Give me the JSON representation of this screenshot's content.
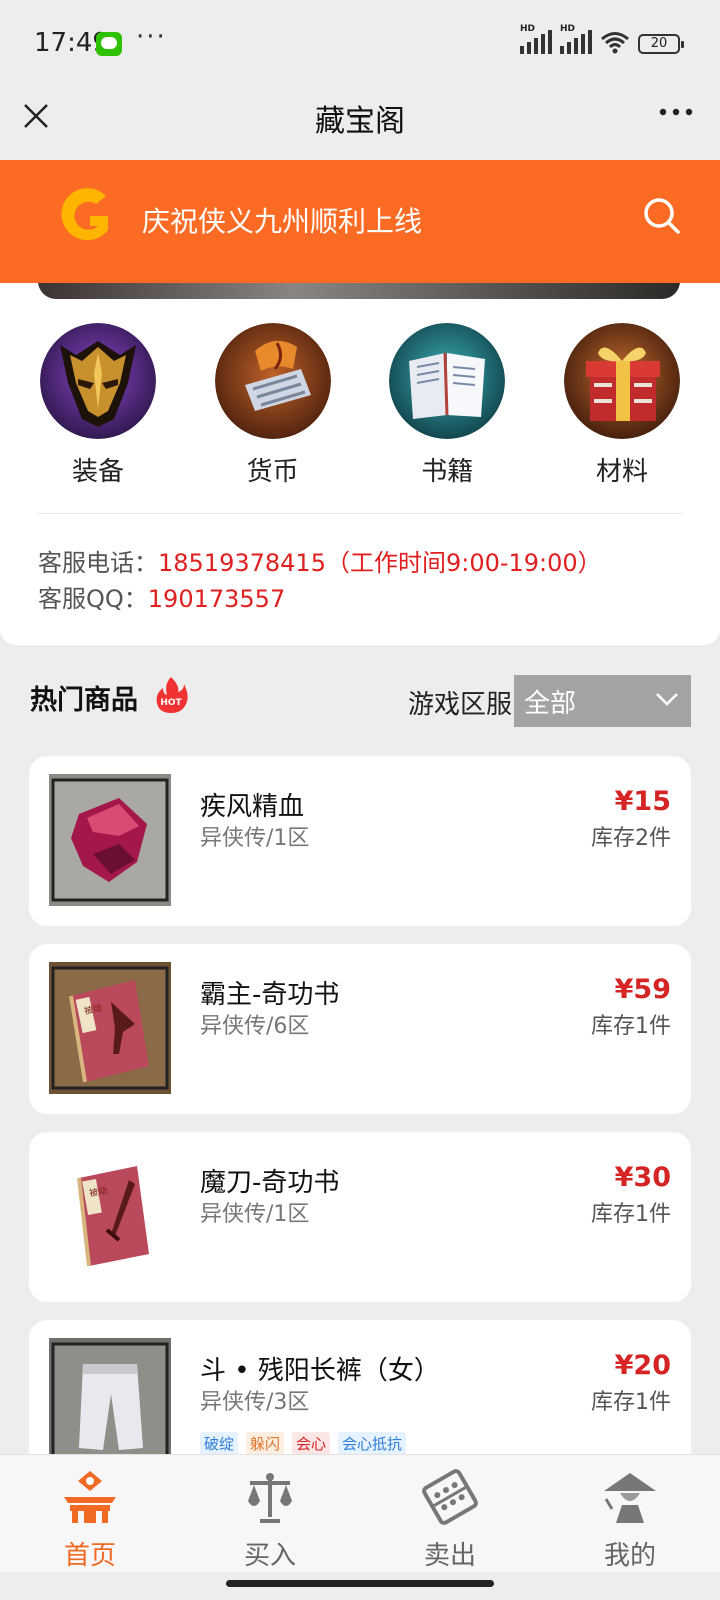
{
  "status_bar": {
    "time": "17:49",
    "battery": "20",
    "hd1": "HD",
    "hd2": "HD"
  },
  "title_bar": {
    "title": "藏宝阁"
  },
  "header": {
    "slogan": "庆祝侠义九州顺利上线"
  },
  "categories": [
    {
      "label": "装备",
      "icon": "equipment-mask-icon"
    },
    {
      "label": "货币",
      "icon": "currency-bag-icon"
    },
    {
      "label": "书籍",
      "icon": "book-icon"
    },
    {
      "label": "材料",
      "icon": "gift-box-icon"
    }
  ],
  "service": {
    "phone_label": "客服电话：",
    "phone_value": "18519378415（工作时间9:00-19:00）",
    "qq_label": "客服QQ：",
    "qq_value": "190173557"
  },
  "hot": {
    "title": "热门商品",
    "badge": "HOT",
    "zone_label": "游戏区服",
    "zone_selected": "全部"
  },
  "items": [
    {
      "name": "疾风精血",
      "zone": "异侠传/1区",
      "price": "¥15",
      "stock": "库存2件",
      "icon": "red-crystal-icon"
    },
    {
      "name": "霸主-奇功书",
      "zone": "异侠传/6区",
      "price": "¥59",
      "stock": "库存1件",
      "icon": "skill-book-axe-icon"
    },
    {
      "name": "魔刀-奇功书",
      "zone": "异侠传/1区",
      "price": "¥30",
      "stock": "库存1件",
      "icon": "skill-book-blade-icon"
    },
    {
      "name": "斗 • 残阳长裤（女）",
      "zone": "异侠传/3区",
      "price": "¥20",
      "stock": "库存1件",
      "icon": "white-pants-icon",
      "tags": [
        "破绽",
        "躲闪",
        "会心",
        "会心抵抗"
      ]
    }
  ],
  "book_stamp": "被动",
  "colors": {
    "accent": "#fb6b23",
    "price": "#d42424",
    "service_value": "#e02020"
  },
  "bottom_nav": [
    {
      "label": "首页",
      "active": true
    },
    {
      "label": "买入",
      "active": false
    },
    {
      "label": "卖出",
      "active": false
    },
    {
      "label": "我的",
      "active": false
    }
  ]
}
